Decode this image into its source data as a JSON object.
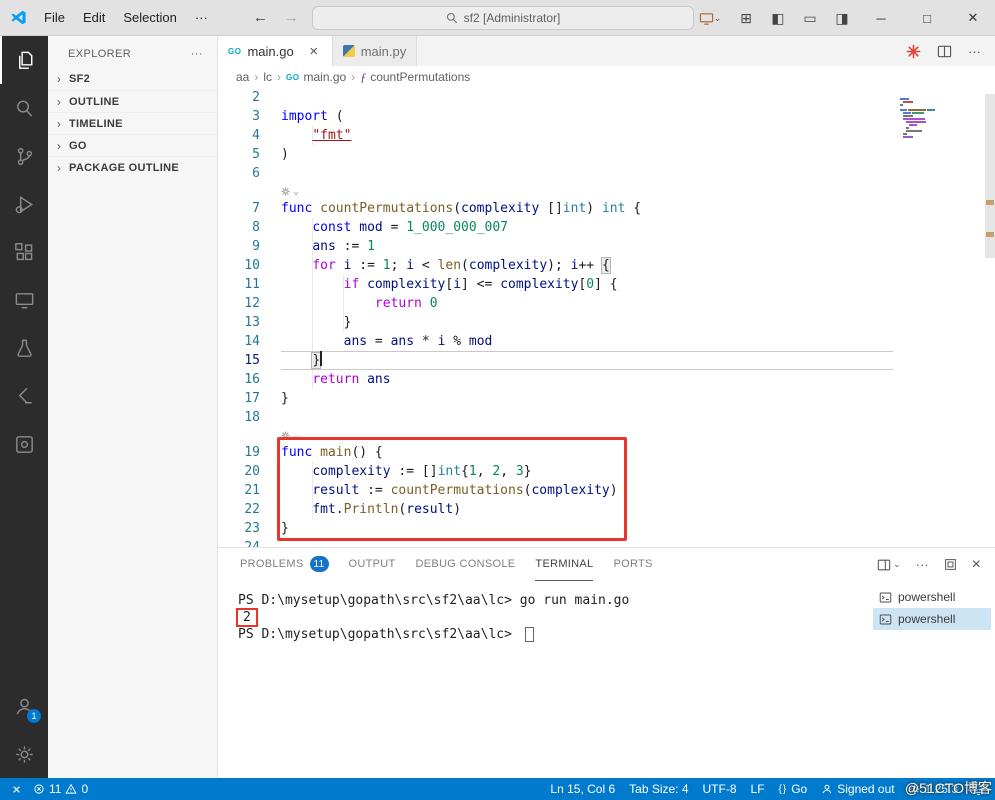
{
  "titlebar": {
    "menus": [
      "File",
      "Edit",
      "Selection"
    ],
    "search_text": "sf2 [Administrator]"
  },
  "activity_bar": {
    "items": [
      {
        "name": "explorer-icon",
        "active": true
      },
      {
        "name": "search-icon"
      },
      {
        "name": "source-control-icon"
      },
      {
        "name": "run-debug-icon"
      },
      {
        "name": "extensions-icon"
      },
      {
        "name": "remote-explorer-icon"
      },
      {
        "name": "testing-icon"
      },
      {
        "name": "leetcode-icon"
      },
      {
        "name": "tools-icon"
      }
    ],
    "account_badge": "1"
  },
  "sidebar": {
    "title": "EXPLORER",
    "sections": [
      {
        "label": "SF2"
      },
      {
        "label": "OUTLINE"
      },
      {
        "label": "TIMELINE"
      },
      {
        "label": "GO"
      },
      {
        "label": "PACKAGE OUTLINE"
      }
    ]
  },
  "editor": {
    "tabs": [
      {
        "label": "main.go",
        "icon": "go",
        "active": true
      },
      {
        "label": "main.py",
        "icon": "python",
        "active": false
      }
    ],
    "breadcrumbs": [
      {
        "label": "aa"
      },
      {
        "label": "lc"
      },
      {
        "label": "main.go",
        "icon": "go"
      },
      {
        "label": "countPermutations",
        "icon": "symbol-function"
      }
    ],
    "lines": [
      {
        "n": 2,
        "tokens": []
      },
      {
        "n": 3,
        "tokens": [
          {
            "t": "import",
            "c": "k"
          },
          {
            "t": " (",
            "c": "p"
          }
        ]
      },
      {
        "n": 4,
        "tokens": [
          {
            "t": "    ",
            "c": "p"
          },
          {
            "t": "\"fmt\"",
            "c": "s u"
          }
        ]
      },
      {
        "n": 5,
        "tokens": [
          {
            "t": ")",
            "c": "p"
          }
        ]
      },
      {
        "n": 6,
        "tokens": []
      },
      {
        "lens": true
      },
      {
        "n": 7,
        "tokens": [
          {
            "t": "func ",
            "c": "k"
          },
          {
            "t": "countPermutations",
            "c": "f"
          },
          {
            "t": "(",
            "c": "p"
          },
          {
            "t": "complexity",
            "c": "v"
          },
          {
            "t": " ",
            "c": "p"
          },
          {
            "t": "[]",
            "c": "p"
          },
          {
            "t": "int",
            "c": "t"
          },
          {
            "t": ") ",
            "c": "p"
          },
          {
            "t": "int",
            "c": "t"
          },
          {
            "t": " {",
            "c": "p"
          }
        ]
      },
      {
        "n": 8,
        "tokens": [
          {
            "t": "    ",
            "c": "p"
          },
          {
            "t": "const",
            "c": "k"
          },
          {
            "t": " ",
            "c": "p"
          },
          {
            "t": "mod",
            "c": "v"
          },
          {
            "t": " = ",
            "c": "p"
          },
          {
            "t": "1_000_000_007",
            "c": "n"
          }
        ]
      },
      {
        "n": 9,
        "tokens": [
          {
            "t": "    ",
            "c": "p"
          },
          {
            "t": "ans",
            "c": "v"
          },
          {
            "t": " := ",
            "c": "p"
          },
          {
            "t": "1",
            "c": "n"
          }
        ]
      },
      {
        "n": 10,
        "tokens": [
          {
            "t": "    ",
            "c": "p"
          },
          {
            "t": "for",
            "c": "c"
          },
          {
            "t": " ",
            "c": "p"
          },
          {
            "t": "i",
            "c": "v"
          },
          {
            "t": " := ",
            "c": "p"
          },
          {
            "t": "1",
            "c": "n"
          },
          {
            "t": "; ",
            "c": "p"
          },
          {
            "t": "i",
            "c": "v"
          },
          {
            "t": " < ",
            "c": "p"
          },
          {
            "t": "len",
            "c": "f"
          },
          {
            "t": "(",
            "c": "p"
          },
          {
            "t": "complexity",
            "c": "v"
          },
          {
            "t": "); ",
            "c": "p"
          },
          {
            "t": "i",
            "c": "v"
          },
          {
            "t": "++ ",
            "c": "p"
          },
          {
            "t": "{",
            "c": "p bm"
          }
        ]
      },
      {
        "n": 11,
        "tokens": [
          {
            "t": "        ",
            "c": "p"
          },
          {
            "t": "if",
            "c": "c"
          },
          {
            "t": " ",
            "c": "p"
          },
          {
            "t": "complexity",
            "c": "v"
          },
          {
            "t": "[",
            "c": "p"
          },
          {
            "t": "i",
            "c": "v"
          },
          {
            "t": "] <= ",
            "c": "p"
          },
          {
            "t": "complexity",
            "c": "v"
          },
          {
            "t": "[",
            "c": "p"
          },
          {
            "t": "0",
            "c": "n"
          },
          {
            "t": "] {",
            "c": "p"
          }
        ]
      },
      {
        "n": 12,
        "tokens": [
          {
            "t": "            ",
            "c": "p"
          },
          {
            "t": "return",
            "c": "c"
          },
          {
            "t": " ",
            "c": "p"
          },
          {
            "t": "0",
            "c": "n"
          }
        ]
      },
      {
        "n": 13,
        "tokens": [
          {
            "t": "        }",
            "c": "p"
          }
        ]
      },
      {
        "n": 14,
        "tokens": [
          {
            "t": "        ",
            "c": "p"
          },
          {
            "t": "ans",
            "c": "v"
          },
          {
            "t": " = ",
            "c": "p"
          },
          {
            "t": "ans",
            "c": "v"
          },
          {
            "t": " * ",
            "c": "p"
          },
          {
            "t": "i",
            "c": "v"
          },
          {
            "t": " % ",
            "c": "p"
          },
          {
            "t": "mod",
            "c": "v"
          }
        ]
      },
      {
        "n": 15,
        "active": true,
        "cursor": true,
        "tokens": [
          {
            "t": "    ",
            "c": "p"
          },
          {
            "t": "}",
            "c": "p bm"
          }
        ]
      },
      {
        "n": 16,
        "tokens": [
          {
            "t": "    ",
            "c": "p"
          },
          {
            "t": "return",
            "c": "c"
          },
          {
            "t": " ",
            "c": "p"
          },
          {
            "t": "ans",
            "c": "v"
          }
        ]
      },
      {
        "n": 17,
        "tokens": [
          {
            "t": "}",
            "c": "p"
          }
        ]
      },
      {
        "n": 18,
        "tokens": []
      },
      {
        "lens": true
      },
      {
        "n": 19,
        "tokens": [
          {
            "t": "func ",
            "c": "k"
          },
          {
            "t": "main",
            "c": "f"
          },
          {
            "t": "() {",
            "c": "p"
          }
        ]
      },
      {
        "n": 20,
        "tokens": [
          {
            "t": "    ",
            "c": "p"
          },
          {
            "t": "complexity",
            "c": "v"
          },
          {
            "t": " := ",
            "c": "p"
          },
          {
            "t": "[]",
            "c": "p"
          },
          {
            "t": "int",
            "c": "t"
          },
          {
            "t": "{",
            "c": "p"
          },
          {
            "t": "1",
            "c": "n"
          },
          {
            "t": ", ",
            "c": "p"
          },
          {
            "t": "2",
            "c": "n"
          },
          {
            "t": ", ",
            "c": "p"
          },
          {
            "t": "3",
            "c": "n"
          },
          {
            "t": "}",
            "c": "p"
          }
        ]
      },
      {
        "n": 21,
        "tokens": [
          {
            "t": "    ",
            "c": "p"
          },
          {
            "t": "result",
            "c": "v"
          },
          {
            "t": " := ",
            "c": "p"
          },
          {
            "t": "countPermutations",
            "c": "f"
          },
          {
            "t": "(",
            "c": "p"
          },
          {
            "t": "complexity",
            "c": "v"
          },
          {
            "t": ")",
            "c": "p"
          }
        ]
      },
      {
        "n": 22,
        "tokens": [
          {
            "t": "    ",
            "c": "p"
          },
          {
            "t": "fmt",
            "c": "v"
          },
          {
            "t": ".",
            "c": "p"
          },
          {
            "t": "Println",
            "c": "f"
          },
          {
            "t": "(",
            "c": "p"
          },
          {
            "t": "result",
            "c": "v"
          },
          {
            "t": ")",
            "c": "p"
          }
        ]
      },
      {
        "n": 23,
        "tokens": [
          {
            "t": "}",
            "c": "p"
          }
        ]
      },
      {
        "n": 24,
        "tokens": []
      }
    ]
  },
  "panel": {
    "tabs": [
      {
        "label": "PROBLEMS",
        "badge": "11"
      },
      {
        "label": "OUTPUT"
      },
      {
        "label": "DEBUG CONSOLE"
      },
      {
        "label": "TERMINAL",
        "active": true
      },
      {
        "label": "PORTS"
      }
    ],
    "terminal": {
      "lines": [
        {
          "prompt": "PS D:\\mysetup\\gopath\\src\\sf2\\aa\\lc>",
          "command": " go run main.go"
        },
        {
          "output": "2",
          "boxed": true
        },
        {
          "prompt": "PS D:\\mysetup\\gopath\\src\\sf2\\aa\\lc> ",
          "cursor": true
        }
      ],
      "list": [
        {
          "label": "powershell",
          "selected": false
        },
        {
          "label": "powershell",
          "selected": true
        }
      ]
    }
  },
  "status_bar": {
    "errors": "11",
    "warnings": "0",
    "right": [
      {
        "label": "Ln 15, Col 6",
        "name": "cursor-position"
      },
      {
        "label": "Tab Size: 4",
        "name": "indentation"
      },
      {
        "label": "UTF-8",
        "name": "encoding"
      },
      {
        "label": "LF",
        "name": "eol"
      },
      {
        "label": "Go",
        "icon": "braces",
        "name": "language-mode"
      },
      {
        "label": "Signed out",
        "icon": "account",
        "name": "accounts"
      },
      {
        "label": "1.25.3",
        "icon": "gear",
        "name": "go-version"
      }
    ]
  },
  "watermark": "@51CTO博客"
}
